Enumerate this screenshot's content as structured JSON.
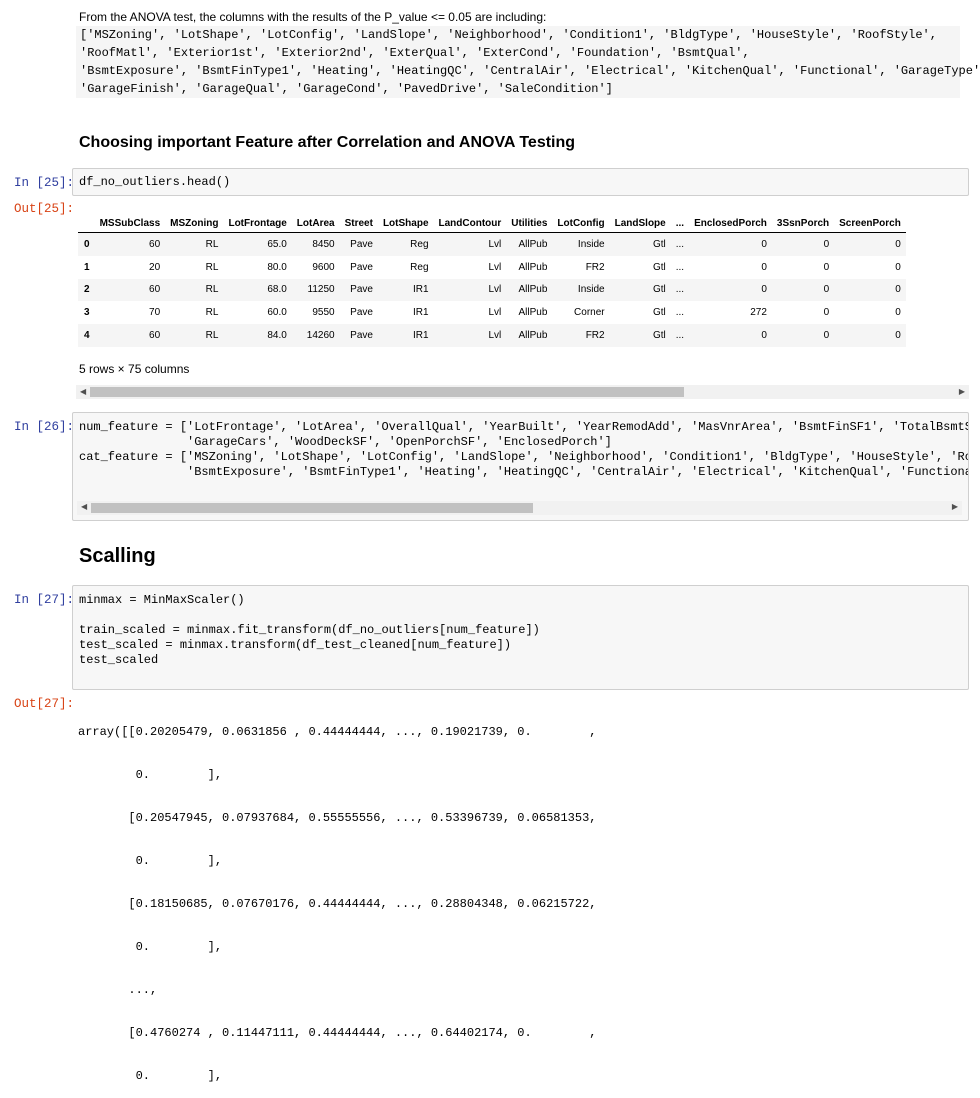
{
  "markdown": {
    "intro": "From the ANOVA test, the columns with the results of the P_value <= 0.05 are including:",
    "code_lines": [
      "['MSZoning', 'LotShape', 'LotConfig', 'LandSlope', 'Neighborhood', 'Condition1', 'BldgType', 'HouseStyle', 'RoofStyle',",
      "'RoofMatl', 'Exterior1st', 'Exterior2nd', 'ExterQual', 'ExterCond', 'Foundation', 'BsmtQual',",
      "'BsmtExposure', 'BsmtFinType1', 'Heating', 'HeatingQC', 'CentralAir', 'Electrical', 'KitchenQual', 'Functional', 'GarageType',",
      "'GarageFinish', 'GarageQual', 'GarageCond', 'PavedDrive', 'SaleCondition']"
    ],
    "heading_features": "Choosing important Feature after Correlation and ANOVA Testing",
    "heading_scaling": "Scalling"
  },
  "cell25": {
    "in_prompt": "In [25]:",
    "out_prompt": "Out[25]:",
    "code": "df_no_outliers.head()",
    "columns": [
      "",
      "MSSubClass",
      "MSZoning",
      "LotFrontage",
      "LotArea",
      "Street",
      "LotShape",
      "LandContour",
      "Utilities",
      "LotConfig",
      "LandSlope",
      "...",
      "EnclosedPorch",
      "3SsnPorch",
      "ScreenPorch"
    ],
    "rows": [
      [
        "0",
        "60",
        "RL",
        "65.0",
        "8450",
        "Pave",
        "Reg",
        "Lvl",
        "AllPub",
        "Inside",
        "Gtl",
        "...",
        "0",
        "0",
        "0"
      ],
      [
        "1",
        "20",
        "RL",
        "80.0",
        "9600",
        "Pave",
        "Reg",
        "Lvl",
        "AllPub",
        "FR2",
        "Gtl",
        "...",
        "0",
        "0",
        "0"
      ],
      [
        "2",
        "60",
        "RL",
        "68.0",
        "11250",
        "Pave",
        "IR1",
        "Lvl",
        "AllPub",
        "Inside",
        "Gtl",
        "...",
        "0",
        "0",
        "0"
      ],
      [
        "3",
        "70",
        "RL",
        "60.0",
        "9550",
        "Pave",
        "IR1",
        "Lvl",
        "AllPub",
        "Corner",
        "Gtl",
        "...",
        "272",
        "0",
        "0"
      ],
      [
        "4",
        "60",
        "RL",
        "84.0",
        "14260",
        "Pave",
        "IR1",
        "Lvl",
        "AllPub",
        "FR2",
        "Gtl",
        "...",
        "0",
        "0",
        "0"
      ]
    ],
    "shape_note": "5 rows × 75 columns"
  },
  "cell26": {
    "in_prompt": "In [26]:",
    "lines": [
      "num_feature = ['LotFrontage', 'LotArea', 'OverallQual', 'YearBuilt', 'YearRemodAdd', 'MasVnrArea', 'BsmtFinSF1', 'TotalBsmtSF', '",
      "               'GarageCars', 'WoodDeckSF', 'OpenPorchSF', 'EnclosedPorch']",
      "cat_feature = ['MSZoning', 'LotShape', 'LotConfig', 'LandSlope', 'Neighborhood', 'Condition1', 'BldgType', 'HouseStyle', 'RoofSty",
      "               'BsmtExposure', 'BsmtFinType1', 'Heating', 'HeatingQC', 'CentralAir', 'Electrical', 'KitchenQual', 'Functional', '"
    ]
  },
  "cell27": {
    "in_prompt": "In [27]:",
    "out_prompt": "Out[27]:",
    "lines": [
      "minmax = MinMaxScaler()",
      "",
      "train_scaled = minmax.fit_transform(df_no_outliers[num_feature])",
      "test_scaled = minmax.transform(df_test_cleaned[num_feature])",
      "test_scaled"
    ],
    "output_lines": [
      "array([[0.20205479, 0.0631856 , 0.44444444, ..., 0.19021739, 0.        ,",
      "        0.        ],",
      "       [0.20547945, 0.07937684, 0.55555556, ..., 0.53396739, 0.06581353,",
      "        0.        ],",
      "       [0.18150685, 0.07670176, 0.44444444, ..., 0.28804348, 0.06215722,",
      "        0.        ],",
      "       ...,",
      "       [0.4760274 , 0.11447111, 0.44444444, ..., 0.64402174, 0.        ,",
      "        0.        ],"
    ]
  },
  "scrollbars": {
    "left_arrow": "◀",
    "right_arrow": "▶"
  }
}
